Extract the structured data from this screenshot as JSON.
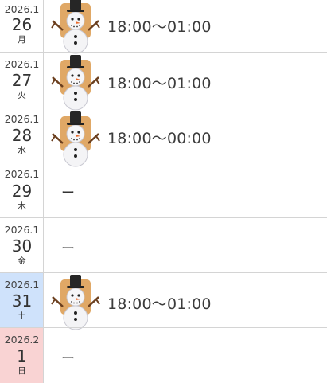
{
  "days": [
    {
      "ym": "2026.1",
      "day": "26",
      "weekday": "月",
      "time": "18:00〜01:00",
      "icon": "snowman-icon"
    },
    {
      "ym": "2026.1",
      "day": "27",
      "weekday": "火",
      "time": "18:00〜01:00",
      "icon": "snowman-icon"
    },
    {
      "ym": "2026.1",
      "day": "28",
      "weekday": "水",
      "time": "18:00〜00:00",
      "icon": "snowman-icon"
    },
    {
      "ym": "2026.1",
      "day": "29",
      "weekday": "木",
      "time": "ー"
    },
    {
      "ym": "2026.1",
      "day": "30",
      "weekday": "金",
      "time": "ー"
    },
    {
      "ym": "2026.1",
      "day": "31",
      "weekday": "土",
      "time": "18:00〜01:00",
      "icon": "snowman-icon"
    },
    {
      "ym": "2026.2",
      "day": "1",
      "weekday": "日",
      "time": "ー"
    }
  ],
  "colors": {
    "saturday_bg": "#cfe2fb",
    "sunday_bg": "#f9d3d3",
    "divider": "#d4d4d4"
  }
}
